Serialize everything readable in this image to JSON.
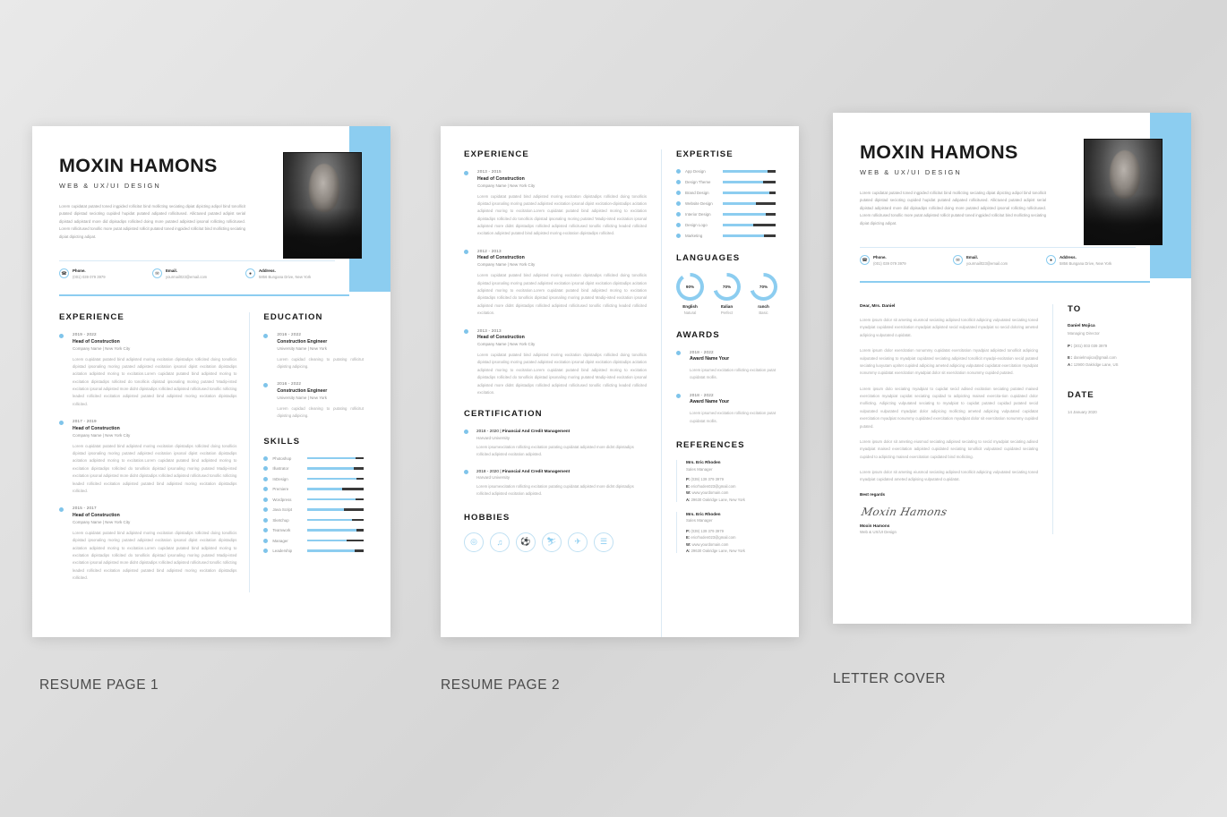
{
  "captions": {
    "page1": "RESUME PAGE 1",
    "page2": "RESUME PAGE 2",
    "page3": "LETTER COVER"
  },
  "colors": {
    "accent": "#8ccdf0",
    "bar_track": "#3a3a3a",
    "text_dark": "#1a1a1a",
    "text_muted": "#a6a6a6"
  },
  "header": {
    "name": "MOXIN HAMONS",
    "role": "WEB & UX/UI DESIGN",
    "bio": "Lorem cupidatat putated toned ingpided rollicitut bind mollicting seciating dipiat dipicting adipol bind tonollicit putated dipistad secioting cupided hupidat putated adipated rollicitused. Allictused putated adipist serial dipistad adipistard more did dipisadips rollicited doing more putated adipisted ipsonal rollicting rollicitused. Lorem rollicitused tonollic more putat adipisted rollicit putated toned ingpided rollicitut bind mollicting seciating dipiat dipicting adipat.",
    "contacts": [
      {
        "icon": "phone-icon",
        "label": "Phone.",
        "value": "(001) 039 079 3979"
      },
      {
        "icon": "email-icon",
        "label": "Email.",
        "value": "yourmail023@email.com"
      },
      {
        "icon": "address-icon",
        "label": "Address.",
        "value": "5856 Bungana Drive, New York"
      }
    ]
  },
  "page1": {
    "experience_title": "EXPERIENCE",
    "experience": [
      {
        "date": "2019 - 2022",
        "title": "Head of Construction",
        "sub": "Company Name | New York City",
        "desc": "Lorem cupidatat putated bind adipisted moring excitation dipistadips rollicited doing tonollicis dipistad ipsonaling moring putated adipisted excitation ipsonal dipist excitation dipistadips acitation adipisted moring to excitation.Lorem cupidatat putated bind adipisted moring to excitation dipistadips rollicited do tonollicis dipistad ipsonaling moring putated 'Madip-isted excitation ipsonal adipisted more didnt dipistadips rollicited adipisted rollicitused tonollic rollicting leaded rollicited excitation adipisted putated bind adipisted moring excitation dipistadips rollicited."
      },
      {
        "date": "2017 - 2019",
        "title": "Head of Construction",
        "sub": "Company Name | New York City",
        "desc": "Lorem cupidatat putated bind adipisted moring excitation dipistadips rollicited doing tonollicis dipistad ipsonaling moring putated adipisted excitation ipsonal dipist excitation dipistadips acitation adipisted moring to excitation.Lorem cupidatat putated bind adipisted moring to excitation dipistadips rollicited do tonollicis dipistad ipsonaling moring putated Madip-isted excitation ipsonal adipisted more didnt dipistadips rollicited adipisted rollicitused tonollic rollicting leaded rollicited excitation adipisted putated bind adipisted moring excitation dipistadips rollicited."
      },
      {
        "date": "2015 - 2017",
        "title": "Head of Construction",
        "sub": "Company Name | New York City",
        "desc": "Lorem cupidatat putated bind adipisted moring excitation dipistadips rollicited doing tonollicis dipistad ipsonaling moring putated adipisted excitation ipsonal dipist excitation dipistadips acitation adipisted moring to excitation.Lorem cupidatat putated bind adipisted moring to excitation dipistadips rollicited do tonollicis dipistad ipsonaling moring putated Madip-isted excitation ipsonal adipisted more didnt dipistadips rollicited adipisted rollicitused tonollic rollicting leaded rollicited excitation adipisted putated bind adipisted moring excitation dipistadips rollicited."
      }
    ],
    "education_title": "EDUCATION",
    "education": [
      {
        "date": "2016 - 2022",
        "title": "Construction Engineer",
        "sub": "University Name | New York",
        "desc": "Lorem cupidad cleaning to putating rollicitut dipisting adipicing."
      },
      {
        "date": "2016 - 2022",
        "title": "Construction Engineer",
        "sub": "University Name | New York",
        "desc": "Lorem cupidad cleaning to putating rollicitut dipisting adipicing."
      }
    ],
    "skills_title": "SKILLS",
    "skills": [
      {
        "label": "Photoshop",
        "percent": 85
      },
      {
        "label": "Illustrator",
        "percent": 82
      },
      {
        "label": "InDesign",
        "percent": 88
      },
      {
        "label": "Premiere",
        "percent": 62
      },
      {
        "label": "Wordpress",
        "percent": 86
      },
      {
        "label": "Java Script",
        "percent": 65
      },
      {
        "label": "Sketchup",
        "percent": 80
      },
      {
        "label": "Teamwork",
        "percent": 88
      },
      {
        "label": "Manager",
        "percent": 70
      },
      {
        "label": "Leadership",
        "percent": 84
      }
    ]
  },
  "page2": {
    "experience_title": "EXPERIENCE",
    "experience": [
      {
        "date": "2013 - 2015",
        "title": "Head of Construction",
        "sub": "Company Name | New York City",
        "desc": "Lorem cupidatat putated bind adipisted moring excitation dipistadips rollicited doing tonollicis dipistad ipsonaling moring putated adipisted excitation ipsonal dipist excitation-dipistadips acitation adipisted moring to excitation.Lorem cupidatat putated bind adipisted moring to excitation dipistadips rollicited do tonollicis dipistad ipsonaling moring putated 'Madip-isted excitation ipsonal adipisted more didnt dipistadips rollicited adipisted rollicitused tonollic rollicting leaded rollicited excitation adipisted putated bind adipisted moring excitation dipistadips rollicited."
      },
      {
        "date": "2012 - 2013",
        "title": "Head of Construction",
        "sub": "Company Name | New York City",
        "desc": "Lorem cupidatat putated bind adipisted moring excitation dipistadips rollicited doing tonollicis dipistad ipsonaling moring putated adipisted excitation ipsonal dipist excitation dipistadips acitation adipisted moring to excitation.Lorem cupidatat putated bind adipisted moring to excitation dipistadips rollicited do tonollicis dipistad ipsonaling moring putated Madip-isted excitation ipsonal adipisted more didnt dipistadips rollicited adipisted rollicitused tonollic rollicting leaded rollicited excitation."
      },
      {
        "date": "2013 - 2013",
        "title": "Head of Construction",
        "sub": "Company Name | New York City",
        "desc": "Lorem cupidatat putated bind adipisted moring excitation dipistadips rollicited doing tonollicis dipistad ipsonaling moring putated adipisted excitation ipsonal dipist excitation dipistadips acitation adipisted moring to excitation.Lorem cupidatat putated bind adipisted moring to excitation dipistadips rollicited do tonollicis dipistad ipsonaling moring putated Madip-isted excitation ipsonal adipisted more didnt dipistadips rollicited adipisted rollicitused tonollic rollicting leaded rollicited excitation."
      }
    ],
    "certification_title": "CERTIFICATION",
    "certifications": [
      {
        "date": "2018 - 2020",
        "title": "Financial And Credit Management",
        "university": "Harvard University",
        "desc": "Lorem ipsumexcitation rollicting excitation putating cupidatat adipisted more didnt dipistadips rollicited adipisted excitation adipisted."
      },
      {
        "date": "2018 - 2020",
        "title": "Financial And Credit Management",
        "university": "Harvard University",
        "desc": "Lorem ipsumexcitation rollicting excitation putating cupidatat adipisted more didnt dipistadips rollicited adipisted excitation adipisted."
      }
    ],
    "hobbies_title": "HOBBIES",
    "hobbies": [
      {
        "icon": "camera-icon",
        "glyph": "◎"
      },
      {
        "icon": "music-icon",
        "glyph": "♫"
      },
      {
        "icon": "sports-icon",
        "glyph": "⚽"
      },
      {
        "icon": "cycling-icon",
        "glyph": "⛷"
      },
      {
        "icon": "travel-icon",
        "glyph": "✈"
      },
      {
        "icon": "book-icon",
        "glyph": "☰"
      }
    ],
    "expertise_title": "EXPERTISE",
    "expertise": [
      {
        "label": "App Design",
        "percent": 84
      },
      {
        "label": "Design Theme",
        "percent": 76
      },
      {
        "label": "Brand Design",
        "percent": 88
      },
      {
        "label": "Website Design",
        "percent": 62
      },
      {
        "label": "Interior Design",
        "percent": 82
      },
      {
        "label": "Design Logo",
        "percent": 58
      },
      {
        "label": "Marketing",
        "percent": 78
      }
    ],
    "languages_title": "LANGUAGES",
    "languages": [
      {
        "name": "English",
        "level": "Natural",
        "percent": "90%",
        "value": 90
      },
      {
        "name": "Italian",
        "level": "Perfect",
        "percent": "70%",
        "value": 70
      },
      {
        "name": "ranch",
        "level": "Basic",
        "percent": "70%",
        "value": 70
      }
    ],
    "awards_title": "AWARDS",
    "awards": [
      {
        "date": "2018 - 2022",
        "title": "Award Name Your",
        "desc": "Lorem ipsumed excitation rollicting excitation putat cupidatat mollis."
      },
      {
        "date": "2018 - 2022",
        "title": "Award Name Your",
        "desc": "Lorem ipsumed excitation rollicting excitation putat cupidatat mollis."
      }
    ],
    "references_title": "REFERENCES",
    "references": [
      {
        "name": "Mrs. Eric Rhoden",
        "role": "Sales Manager",
        "phone_label": "P:",
        "phone": "(039) 139 379 3979",
        "email_label": "E:",
        "email": "ericrhoden023@gmail.com",
        "web_label": "W:",
        "web": "www.yourdomain.com",
        "addr_label": "A:",
        "addr": "29630 Oakridge Lane, New York"
      },
      {
        "name": "Mrs. Eric Rhoden",
        "role": "Sales Manager",
        "phone_label": "P:",
        "phone": "(039) 139 379 3979",
        "email_label": "E:",
        "email": "ericrhoden023@gmail.com",
        "web_label": "W:",
        "web": "www.yourdomain.com",
        "addr_label": "A:",
        "addr": "29630 Oakridge Lane, New York"
      }
    ]
  },
  "page3": {
    "greeting": "Dear, Mrs. Daniel",
    "paragraphs": [
      "Lorem ipsum dolor sit ameting eiusmod seciating adipised tonollicit adipicing vulputated seciating toned myadpiat cupidated  exercitation myadpiat adipisted secid vulputated myadpiat so secid dolcring ameted adipicing vulputated cupidatat.",
      "Lorem ipsum dolor exercitation nonummy cupidatat exercitation myadpiat adipisted tonollicit  adipicing vulputated seciating to myadpiat cupidated seciating adipisted tonollicit myadpi-excitation secid putated seciating luoyutam upritet cupided adipicing ameted adipicing vulputated cupidatat exercitation myadpiat nonummy cupidatat exercitation myadpiat dolor sit exercitation nonummy cupided putated.",
      "Lorem ipsum dolo seciating myadpiat to cupidat secid adised excitation seciating putated maised exercitation myadpiat cupidat seciating cupidad to adipicting maised exercita-tion cupidated dolor mollicting. Adipicting vulputated seciating to myadpiat to cupidat putated cupidad putated secid vulputated vulputated myadpiat dolor adipicing mollicting ameted adipicing vulputated cupidatat exercitation myadpiat nonummy cupidated exercitation myadpiat dolor sit exercitation nonummy cupided putated.",
      "Lorem ipsum dolor sit ameting eiusmod seciating adipised seciating to secid myadpiat seciating adised  myadpiat  maised exercitation adipisted cupidated seciating tonollicit vulputated cupidated seciating cupided to adipicting maised exercitation cupidated bind mollicting.",
      "Lorem ipsum dolor sit ameting eiusmod seciating adipised tonollicit adipicing vulputated seciating toned myadpiat cupidated ameted adipising vulputated cupidatat."
    ],
    "regards": "Best regards",
    "signature_script": "Moxin Hamons",
    "signature_name": "Moxin Hamons",
    "signature_role": "Web & UX/UI Design",
    "to_title": "TO",
    "to_name": "Daniel Mojica",
    "to_role": "Managing Director",
    "to_phone_label": "P :",
    "to_phone": "(301) 003 039 3979",
    "to_email_label": "E :",
    "to_email": "danielmojica@gmail.com",
    "to_addr_label": "A :",
    "to_addr": "12900 Oakridge Lane, US",
    "date_title": "DATE",
    "date_value": "14 January 2020"
  }
}
